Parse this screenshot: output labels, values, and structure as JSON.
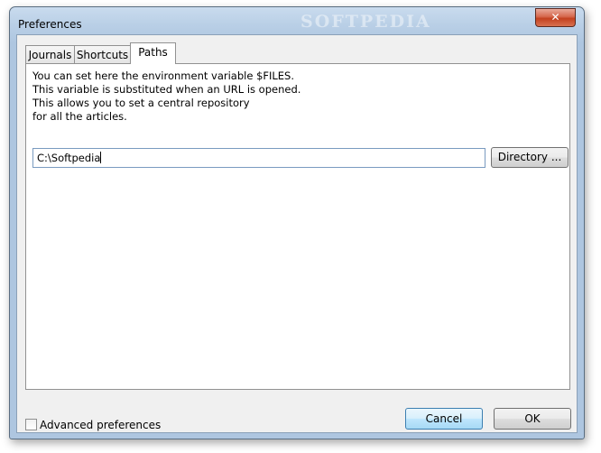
{
  "window": {
    "title": "Preferences",
    "watermark": "SOFTPEDIA",
    "close_glyph": "✕"
  },
  "tabs": [
    {
      "label": "Journals",
      "active": false
    },
    {
      "label": "Shortcuts",
      "active": false
    },
    {
      "label": "Paths",
      "active": true
    }
  ],
  "paths_panel": {
    "description": [
      "You can set here the environment variable $FILES.",
      "This variable is substituted when an URL is opened.",
      "This allows you to set a central repository",
      "for all the articles."
    ],
    "path_value": "C:\\Softpedia",
    "directory_button": "Directory ..."
  },
  "footer": {
    "advanced_label": "Advanced preferences",
    "advanced_checked": false,
    "cancel_label": "Cancel",
    "ok_label": "OK"
  },
  "colors": {
    "title_bar": "#b9cfe6",
    "close_button": "#c3401f",
    "hover_button": "#bee6fd"
  }
}
